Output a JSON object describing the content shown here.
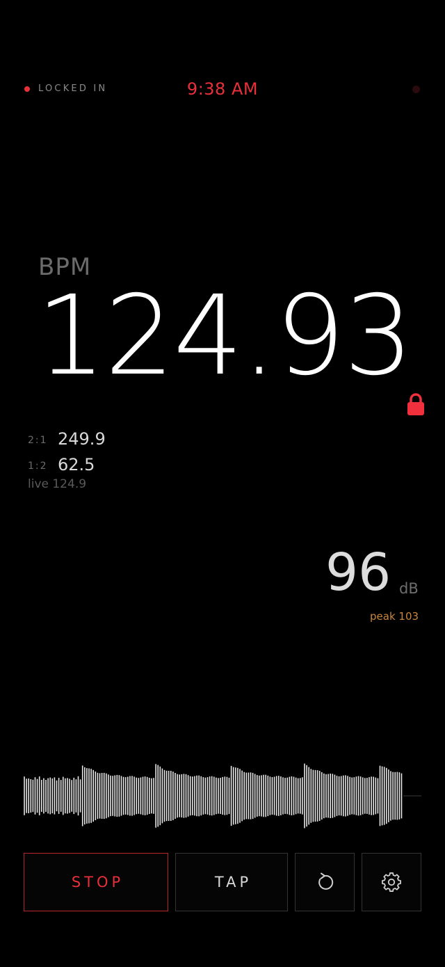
{
  "status": {
    "label": "LOCKED IN",
    "time": "9:38 AM"
  },
  "tempo": {
    "label": "BPM",
    "value": "124.93",
    "locked": true,
    "ratios": [
      {
        "key": "2:1",
        "value": "249.9"
      },
      {
        "key": "1:2",
        "value": "62.5"
      }
    ],
    "live": "live 124.9"
  },
  "level": {
    "value": "96",
    "unit": "dB",
    "peak": "peak 103"
  },
  "controls": {
    "stop_label": "STOP",
    "tap_label": "TAP",
    "reset_icon": "reset-icon",
    "settings_icon": "gear-icon"
  },
  "colors": {
    "accent": "#e8303a",
    "peak": "#c8863a",
    "background": "#000000"
  }
}
